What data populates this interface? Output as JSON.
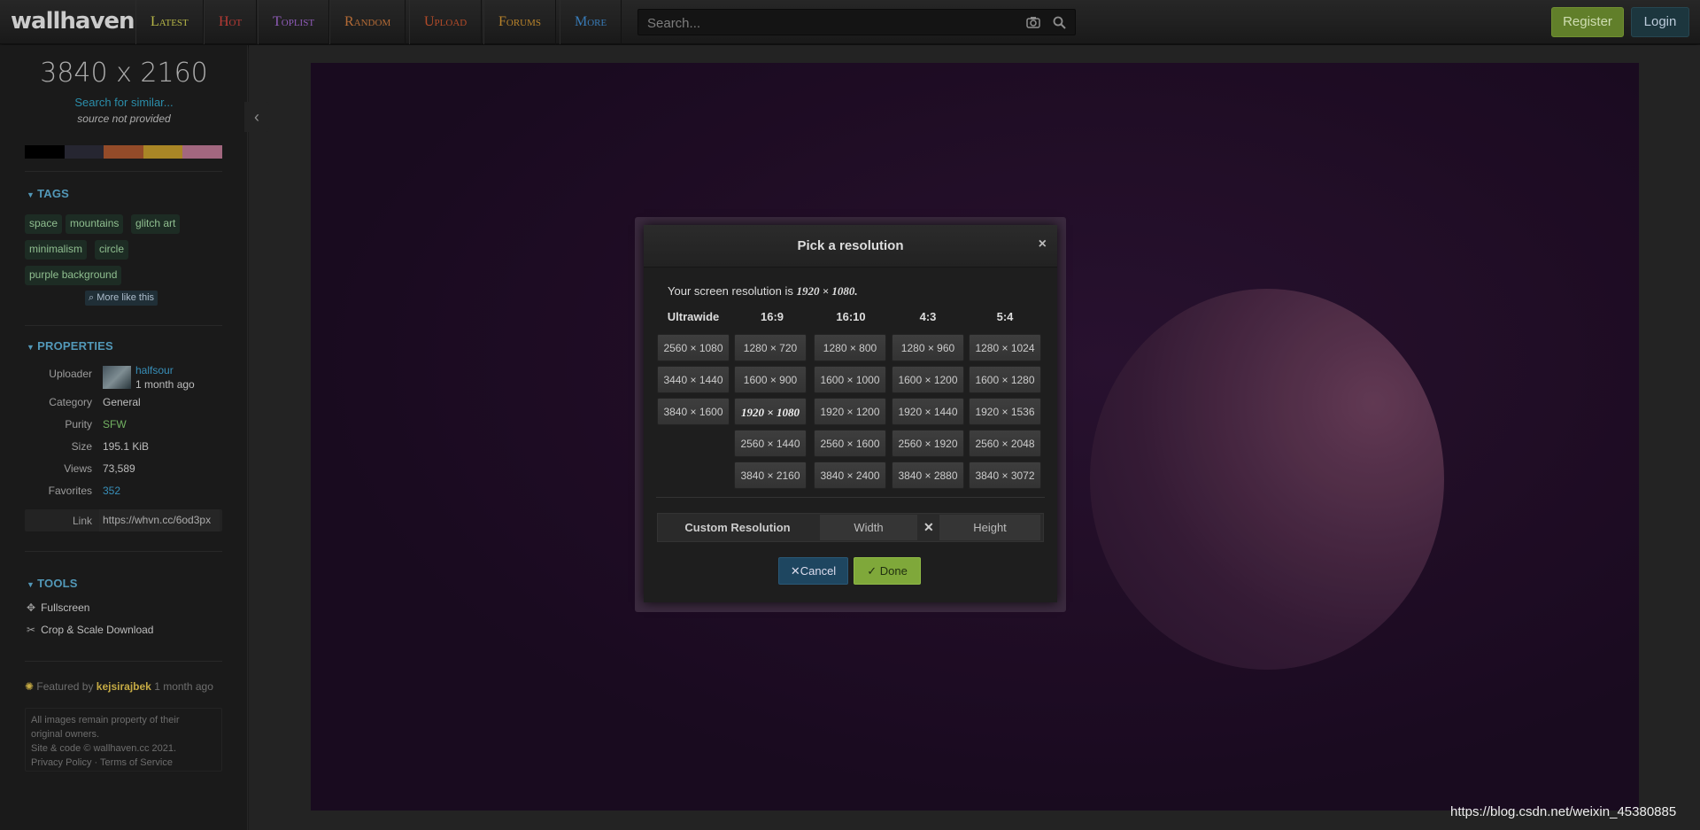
{
  "header": {
    "logo": "wallhaven",
    "nav": [
      {
        "label": "Latest",
        "color": "#c7c74e"
      },
      {
        "label": "Hot",
        "color": "#c9403a"
      },
      {
        "label": "Toplist",
        "color": "#9b63c7"
      },
      {
        "label": "Random",
        "color": "#c4753b"
      },
      {
        "label": "Upload",
        "color": "#c4522d"
      },
      {
        "label": "Forums",
        "color": "#c98f2f"
      },
      {
        "label": "More",
        "color": "#3d85c6"
      }
    ],
    "search_placeholder": "Search...",
    "register_label": "Register",
    "login_label": "Login"
  },
  "sidebar": {
    "resolution": "3840 x 2160",
    "search_similar": "Search for similar...",
    "source_note": "source not provided",
    "palette": [
      "#000000",
      "#2a2a36",
      "#a0522d",
      "#b8922a",
      "#b0708a"
    ],
    "tags_heading": "TAGS",
    "tags": [
      "space",
      "mountains",
      "glitch art",
      "minimalism",
      "circle",
      "purple background"
    ],
    "more_like_this": "More like this",
    "properties_heading": "PROPERTIES",
    "properties": {
      "uploader_label": "Uploader",
      "uploader_name": "halfsour",
      "uploader_time": "1 month ago",
      "category_label": "Category",
      "category_value": "General",
      "purity_label": "Purity",
      "purity_value": "SFW",
      "size_label": "Size",
      "size_value": "195.1 KiB",
      "views_label": "Views",
      "views_value": "73,589",
      "favorites_label": "Favorites",
      "favorites_value": "352",
      "link_label": "Link",
      "link_value": "https://whvn.cc/6od3px"
    },
    "tools_heading": "TOOLS",
    "tools": [
      "Fullscreen",
      "Crop & Scale Download"
    ],
    "featured_prefix": "Featured by",
    "featured_user": "kejsirajbek",
    "featured_time": "1 month ago",
    "footer": {
      "line1": "All images remain property of their",
      "line2": "original owners.",
      "line3": "Site & code © wallhaven.cc 2021.",
      "line4": "Privacy Policy · Terms of Service"
    }
  },
  "modal": {
    "title": "Pick a resolution",
    "close": "×",
    "screen_res_prefix": "Your screen resolution is",
    "screen_res_value": "1920 × 1080.",
    "columns": [
      {
        "head": "Ultrawide",
        "items": [
          "2560 × 1080",
          "3440 × 1440",
          "3840 × 1600"
        ]
      },
      {
        "head": "16:9",
        "items": [
          "1280 × 720",
          "1600 × 900",
          "1920 × 1080",
          "2560 × 1440",
          "3840 × 2160"
        ]
      },
      {
        "head": "16:10",
        "items": [
          "1280 × 800",
          "1600 × 1000",
          "1920 × 1200",
          "2560 × 1600",
          "3840 × 2400"
        ]
      },
      {
        "head": "4:3",
        "items": [
          "1280 × 960",
          "1600 × 1200",
          "1920 × 1440",
          "2560 × 1920",
          "3840 × 2880"
        ]
      },
      {
        "head": "5:4",
        "items": [
          "1280 × 1024",
          "1600 × 1280",
          "1920 × 1536",
          "2560 × 2048",
          "3840 × 3072"
        ]
      }
    ],
    "custom_label": "Custom Resolution",
    "width_placeholder": "Width",
    "height_placeholder": "Height",
    "times": "✕",
    "cancel_label": "Cancel",
    "done_label": "Done"
  },
  "watermark": "https://blog.csdn.net/weixin_45380885"
}
